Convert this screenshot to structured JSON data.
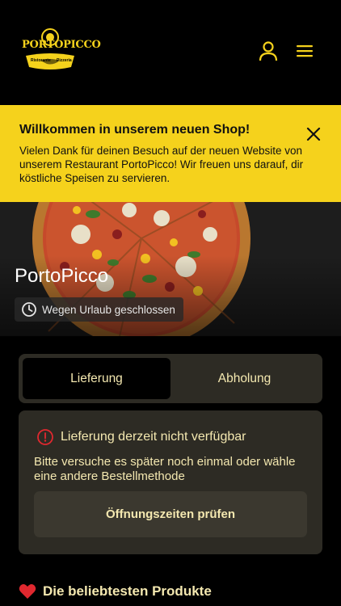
{
  "header": {
    "logo": {
      "text": "PORTOPICCO",
      "sub_left": "Ristorante",
      "sub_right": "Pizzeria"
    },
    "icons": {
      "account": "user-icon",
      "menu": "hamburger-icon"
    }
  },
  "banner": {
    "title": "Willkommen in unserem neuen Shop!",
    "text": "Vielen Dank für deinen Besuch auf der neuen Website von unserem Restaurant PortoPicco! Wir freuen uns darauf, dir köstliche Speisen zu servieren.",
    "close_icon": "close-icon",
    "color": "#f5d21c"
  },
  "hero": {
    "restaurant_name": "PortoPicco",
    "status": "Wegen Urlaub geschlossen",
    "status_icon": "clock-icon"
  },
  "order_method": {
    "tabs": [
      {
        "label": "Lieferung",
        "active": true
      },
      {
        "label": "Abholung",
        "active": false
      }
    ]
  },
  "delivery_info": {
    "title": "Lieferung derzeit nicht verfügbar",
    "title_icon": "alert-circle-icon",
    "message": "Bitte versuche es später noch einmal oder wähle eine andere Bestellmethode",
    "button_label": "Öffnungszeiten prüfen"
  },
  "popular": {
    "title": "Die beliebtesten Produkte",
    "icon": "heart-icon",
    "icon_color": "#e0282f"
  },
  "theme": {
    "accent": "#f5d21c",
    "text": "#f4e8b0",
    "card": "#2d2b24"
  }
}
